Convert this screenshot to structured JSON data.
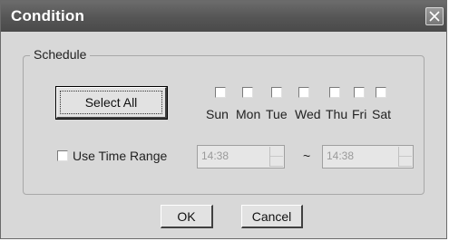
{
  "window": {
    "title": "Condition"
  },
  "schedule": {
    "group_label": "Schedule",
    "select_all_label": "Select All",
    "days": [
      {
        "label": "Sun",
        "checked": false
      },
      {
        "label": "Mon",
        "checked": false
      },
      {
        "label": "Tue",
        "checked": false
      },
      {
        "label": "Wed",
        "checked": false
      },
      {
        "label": "Thu",
        "checked": false
      },
      {
        "label": "Fri",
        "checked": false
      },
      {
        "label": "Sat",
        "checked": false
      }
    ],
    "use_time_range": {
      "label": "Use Time Range",
      "checked": false
    },
    "start_time": {
      "value": "14:38",
      "enabled": false
    },
    "range_separator": "~",
    "end_time": {
      "value": "14:38",
      "enabled": false
    }
  },
  "buttons": {
    "ok_label": "OK",
    "cancel_label": "Cancel"
  },
  "icons": {
    "close": "close-icon",
    "spin_up": "chevron-up-icon",
    "spin_down": "chevron-down-icon"
  }
}
